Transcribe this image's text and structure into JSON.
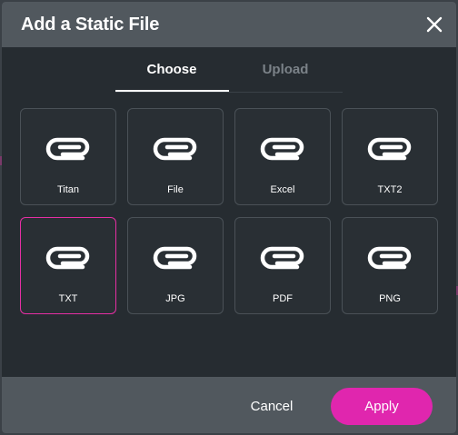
{
  "dialog": {
    "title": "Add a Static File",
    "close_icon": "close-icon"
  },
  "tabs": [
    {
      "label": "Choose",
      "active": true
    },
    {
      "label": "Upload",
      "active": false
    }
  ],
  "files": [
    {
      "label": "Titan",
      "icon": "paperclip-icon",
      "selected": false
    },
    {
      "label": "File",
      "icon": "paperclip-icon",
      "selected": false
    },
    {
      "label": "Excel",
      "icon": "paperclip-icon",
      "selected": false
    },
    {
      "label": "TXT2",
      "icon": "paperclip-icon",
      "selected": false
    },
    {
      "label": "TXT",
      "icon": "paperclip-icon",
      "selected": true
    },
    {
      "label": "JPG",
      "icon": "paperclip-icon",
      "selected": false
    },
    {
      "label": "PDF",
      "icon": "paperclip-icon",
      "selected": false
    },
    {
      "label": "PNG",
      "icon": "paperclip-icon",
      "selected": false
    }
  ],
  "footer": {
    "cancel_label": "Cancel",
    "apply_label": "Apply"
  },
  "colors": {
    "accent": "#e026ae",
    "header_bg": "#51585e",
    "body_bg": "#262c31"
  }
}
